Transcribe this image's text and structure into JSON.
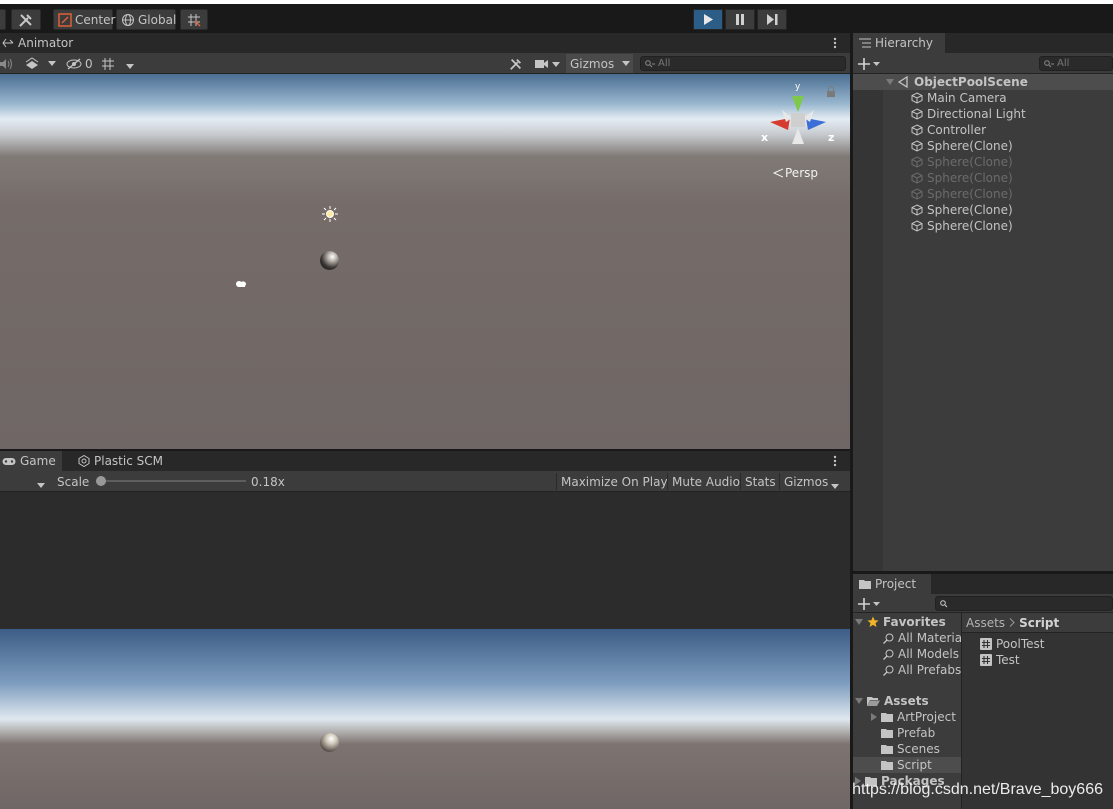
{
  "toolbar": {
    "center_label": "Center",
    "global_label": "Global"
  },
  "scene_panel": {
    "tab_label": "Animator",
    "visibility_count": "0",
    "gizmos_label": "Gizmos",
    "search_placeholder": "All",
    "persp_label": "Persp",
    "axis_x": "x",
    "axis_z": "z",
    "axis_y": "y"
  },
  "game_panel": {
    "tabs": [
      {
        "label": "Game"
      },
      {
        "label": "Plastic SCM"
      }
    ],
    "scale_label": "Scale",
    "scale_value": "0.18x",
    "scale_fraction": 0.0,
    "buttons": [
      {
        "label": "Maximize On Play"
      },
      {
        "label": "Mute Audio"
      },
      {
        "label": "Stats"
      },
      {
        "label": "Gizmos"
      }
    ]
  },
  "hierarchy": {
    "tab_label": "Hierarchy",
    "search_placeholder": "All",
    "scene_name": "ObjectPoolScene",
    "items": [
      {
        "label": "Main Camera",
        "active": true
      },
      {
        "label": "Directional Light",
        "active": true
      },
      {
        "label": "Controller",
        "active": true
      },
      {
        "label": "Sphere(Clone)",
        "active": true
      },
      {
        "label": "Sphere(Clone)",
        "active": false
      },
      {
        "label": "Sphere(Clone)",
        "active": false
      },
      {
        "label": "Sphere(Clone)",
        "active": false
      },
      {
        "label": "Sphere(Clone)",
        "active": true
      },
      {
        "label": "Sphere(Clone)",
        "active": true
      }
    ]
  },
  "project": {
    "tab_label": "Project",
    "favorites_label": "Favorites",
    "favorites": [
      {
        "label": "All Materia"
      },
      {
        "label": "All Models"
      },
      {
        "label": "All Prefabs"
      }
    ],
    "assets_label": "Assets",
    "folders": [
      {
        "label": "ArtProject"
      },
      {
        "label": "Prefab"
      },
      {
        "label": "Scenes"
      },
      {
        "label": "Script"
      }
    ],
    "packages_label": "Packages",
    "breadcrumb_root": "Assets",
    "breadcrumb_current": "Script",
    "files": [
      {
        "label": "PoolTest"
      },
      {
        "label": "Test"
      }
    ]
  },
  "watermark": "https://blog.csdn.net/Brave_boy666"
}
